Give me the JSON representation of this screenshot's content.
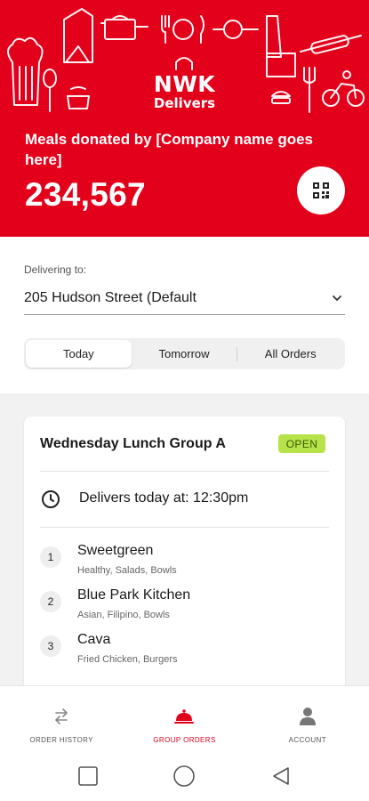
{
  "brand": {
    "logo_main": "NWK",
    "logo_sub": "Delivers",
    "primary_color": "#e3001b"
  },
  "hero": {
    "donated_label": "Meals donated by [Company name goes here]",
    "donated_count": "234,567",
    "qr_icon": "qr-code-icon"
  },
  "delivery": {
    "label": "Delivering to:",
    "address": "205 Hudson Street (Default"
  },
  "tabs": [
    {
      "label": "Today",
      "active": true
    },
    {
      "label": "Tomorrow",
      "active": false
    },
    {
      "label": "All Orders",
      "active": false
    }
  ],
  "group": {
    "title": "Wednesday Lunch Group A",
    "status": "OPEN",
    "status_color": "#b7e34a",
    "delivery_time": "Delivers today at: 12:30pm",
    "restaurants": [
      {
        "number": "1",
        "name": "Sweetgreen",
        "tags": "Healthy, Salads, Bowls"
      },
      {
        "number": "2",
        "name": "Blue Park Kitchen",
        "tags": "Asian, Filipino, Bowls"
      },
      {
        "number": "3",
        "name": "Cava",
        "tags": "Fried Chicken, Burgers"
      }
    ]
  },
  "nav": {
    "items": [
      {
        "label": "ORDER HISTORY",
        "icon": "swap-arrows-icon",
        "active": false
      },
      {
        "label": "GROUP ORDERS",
        "icon": "cloche-icon",
        "active": true
      },
      {
        "label": "ACCOUNT",
        "icon": "person-icon",
        "active": false
      }
    ]
  }
}
